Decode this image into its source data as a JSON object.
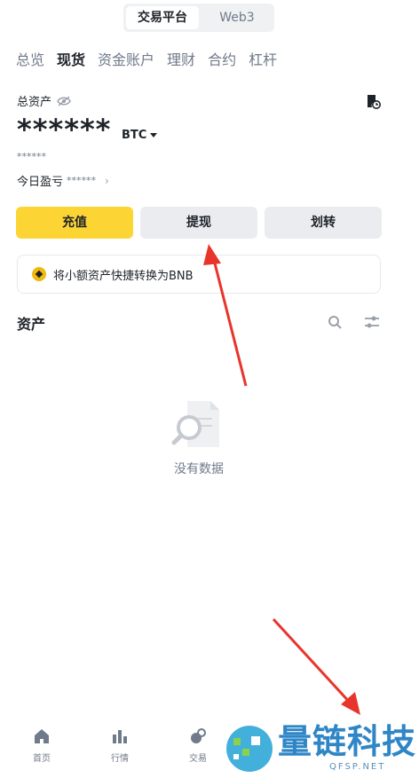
{
  "top_switch": {
    "active": "交易平台",
    "inactive": "Web3"
  },
  "tabs": [
    {
      "label": "总览",
      "active": false
    },
    {
      "label": "现货",
      "active": true
    },
    {
      "label": "资金账户",
      "active": false
    },
    {
      "label": "理财",
      "active": false
    },
    {
      "label": "合约",
      "active": false
    },
    {
      "label": "杠杆",
      "active": false
    }
  ],
  "assets": {
    "label": "总资产",
    "balance": "******",
    "currency": "BTC",
    "btc_sub": "******",
    "pnl_label": "今日盈亏",
    "pnl_value": "******"
  },
  "actions": {
    "deposit": "充值",
    "withdraw": "提现",
    "transfer": "划转"
  },
  "banner": {
    "text": "将小额资产快捷转换为BNB"
  },
  "section": {
    "title": "资产"
  },
  "empty": {
    "text": "没有数据"
  },
  "bottom_nav": {
    "home": "首页",
    "market": "行情",
    "trade": "交易"
  },
  "watermark": {
    "title": "量链科技",
    "sub": "QFSP.NET"
  },
  "colors": {
    "accent": "#fcd535",
    "arrow": "#e8352b",
    "watermark": "#2f86c6"
  }
}
